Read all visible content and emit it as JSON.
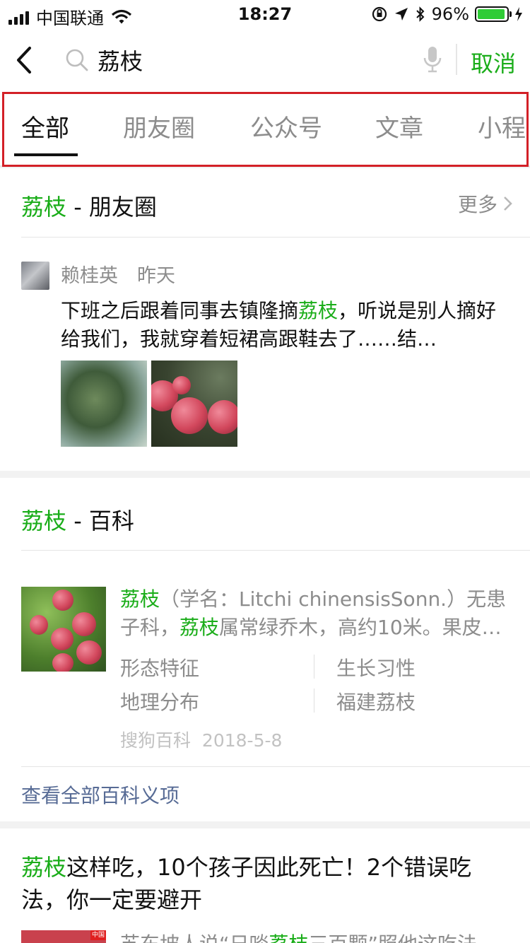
{
  "status_bar": {
    "carrier": "中国联通",
    "time": "18:27",
    "battery_percent": "96%",
    "battery_level": 0.96,
    "icons": [
      "signal-icon",
      "wifi-icon",
      "orientation-lock-icon",
      "location-icon",
      "bluetooth-icon",
      "battery-icon",
      "charging-icon"
    ]
  },
  "search": {
    "query": "荔枝",
    "cancel_label": "取消"
  },
  "tabs": [
    "全部",
    "朋友圈",
    "公众号",
    "文章",
    "小程"
  ],
  "moments_section": {
    "keyword": "荔枝",
    "suffix": " - 朋友圈",
    "more_label": "更多",
    "post": {
      "author": "赖桂英",
      "time": "昨天",
      "text_before": "下班之后跟着同事去镇隆摘",
      "text_keyword": "荔枝",
      "text_after": "，听说是别人摘好给我们，我就穿着短裙高跟鞋去了……结…"
    }
  },
  "baike_section": {
    "keyword": "荔枝",
    "suffix": " - 百科",
    "desc_kw1": "荔枝",
    "desc_part1": "（学名：Litchi chinensisSonn.）无患子科，",
    "desc_kw2": "荔枝",
    "desc_part2": "属常绿乔木，高约10米。果皮…",
    "attributes": [
      "形态特征",
      "生长习性",
      "地理分布",
      "福建荔枝"
    ],
    "source": "搜狗百科",
    "date": "2018-5-8",
    "view_all": "查看全部百科义项"
  },
  "article_section": {
    "title_keyword": "荔枝",
    "title_rest": "这样吃，10个孩子因此死亡！2个错误吃法，你一定要避开",
    "snippet_before": "苏东坡人说“日啖",
    "snippet_keyword": "荔枝",
    "snippet_after": "三百颗”照他这吃法",
    "thumb_tag": "中国"
  },
  "colors": {
    "accent_green": "#1aad19",
    "link_blue": "#576b95",
    "highlight_frame_red": "#d32027"
  }
}
